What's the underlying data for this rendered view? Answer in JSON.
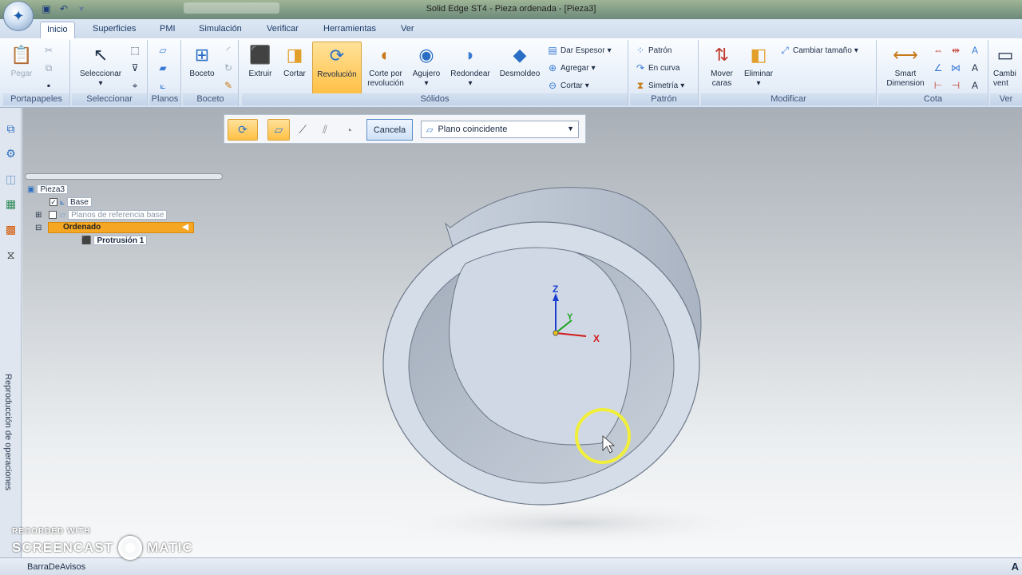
{
  "title": "Solid Edge ST4 - Pieza ordenada - [Pieza3]",
  "tabs": [
    "Inicio",
    "Superficies",
    "PMI",
    "Simulación",
    "Verificar",
    "Herramientas",
    "Ver"
  ],
  "ribbon": {
    "portapapeles": {
      "label": "Portapapeles",
      "paste": "Pegar"
    },
    "seleccionar": {
      "label": "Seleccionar",
      "select": "Seleccionar"
    },
    "planos": {
      "label": "Planos"
    },
    "boceto": {
      "label": "Boceto",
      "sketch": "Boceto"
    },
    "solidos": {
      "label": "Sólidos",
      "extruir": "Extruir",
      "cortar": "Cortar",
      "revolucion": "Revolución",
      "corte_line1": "Corte por",
      "corte_line2": "revolución",
      "agujero": "Agujero",
      "redondear": "Redondear",
      "desmoldeo": "Desmoldeo",
      "dar_espesor": "Dar Espesor",
      "agregar": "Agregar",
      "cortar_small": "Cortar"
    },
    "patron": {
      "label": "Patrón",
      "patron": "Patrón",
      "en_curva": "En curva",
      "simetria": "Simetría"
    },
    "modificar": {
      "label": "Modificar",
      "mover_line1": "Mover",
      "mover_line2": "caras",
      "eliminar": "Eliminar",
      "cambiar_tamano": "Cambiar tamaño"
    },
    "cota": {
      "label": "Cota",
      "smart_line1": "Smart",
      "smart_line2": "Dimension"
    },
    "extra": {
      "label": "Ver",
      "btn_line1": "Cambi",
      "btn_line2": "vent"
    }
  },
  "commandbar": {
    "cancel": "Cancela",
    "plane": "Plano coincidente"
  },
  "tree": {
    "root": "Pieza3",
    "base": "Base",
    "ref_planes": "Planos de referencia base",
    "ordered": "Ordenado",
    "protrusion": "Protrusión 1"
  },
  "sidebar": {
    "vertical_label": "Reproducción de operaciones"
  },
  "axes": {
    "z": "Z",
    "y": "Y",
    "x": "X"
  },
  "status": {
    "text": "BarraDeAvisos",
    "right": "A"
  },
  "watermark": {
    "line1": "RECORDED WITH",
    "line2a": "SCREENCAST",
    "line2b": "MATIC"
  },
  "colors": {
    "highlight": "#ffc045",
    "ordered_bar": "#f5a623",
    "part": "#d4dde8"
  }
}
